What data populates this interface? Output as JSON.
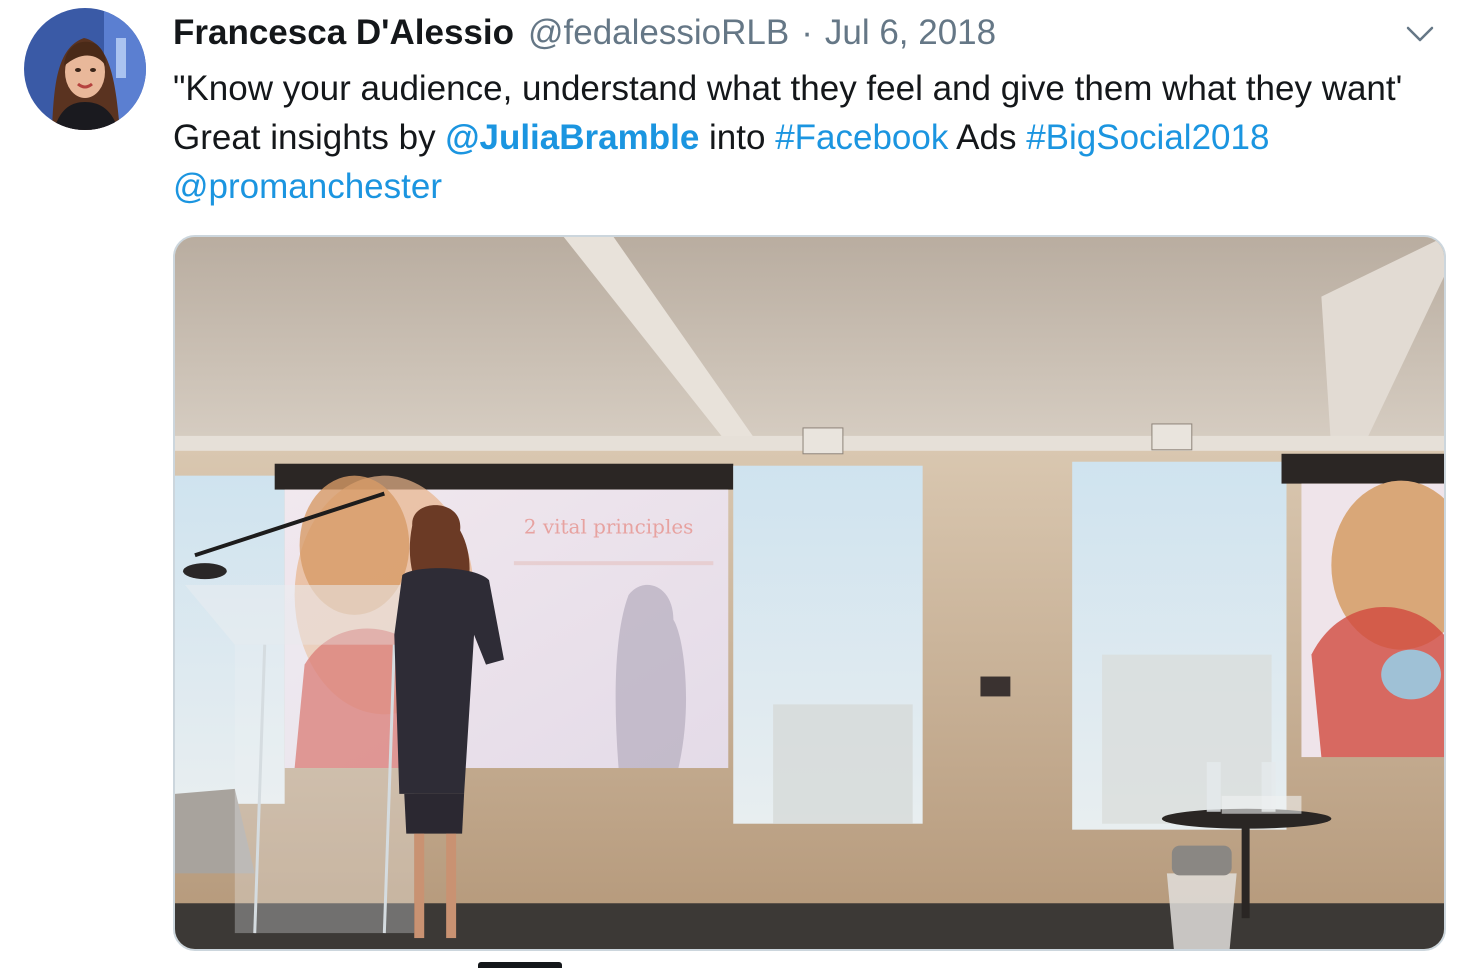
{
  "tweet": {
    "author_name": "Francesca D'Alessio",
    "handle": "@fedalessioRLB",
    "separator": "·",
    "date": "Jul 6, 2018",
    "text_1": "\"Know your audience, understand what they feel and give them what they want' Great insights by ",
    "mention_1": "@JuliaBramble",
    "text_2": " into ",
    "hashtag_1": "#Facebook",
    "text_3": " Ads ",
    "hashtag_2": "#BigSocial2018",
    "text_4": " ",
    "mention_2": "@promanchester"
  },
  "media": {
    "slide_title": "2 vital principles"
  },
  "icons": {
    "menu": "chevron-down-icon",
    "avatar": "avatar"
  },
  "colors": {
    "link": "#1b95e0",
    "secondary_text": "#657786",
    "border": "#ccd6dd"
  }
}
